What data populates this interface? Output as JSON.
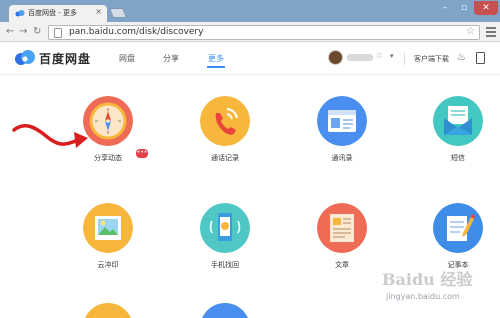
{
  "browser": {
    "tab_title": "百度网盘 - 更多",
    "tab_close": "×",
    "url": "pan.baidu.com/disk/discovery",
    "back_icon": "arrow-left",
    "forward_icon": "arrow-right",
    "reload_icon": "reload",
    "star_icon": "☆"
  },
  "window": {
    "minimize": "–",
    "maximize": "▫",
    "close": "✕"
  },
  "header": {
    "logo_text": "百度网盘",
    "nav": [
      {
        "label": "网盘",
        "active": false
      },
      {
        "label": "分享",
        "active": false
      },
      {
        "label": "更多",
        "active": true
      }
    ],
    "client_download": "客户端下载",
    "caret": "▾",
    "badge": "♔",
    "bell": "🔔"
  },
  "apps": [
    {
      "label": "分享动态",
      "icon": "compass-icon",
      "color": "#f06b55",
      "new_badge": "•••"
    },
    {
      "label": "通话记录",
      "icon": "phone-icon",
      "color": "#f7b63c"
    },
    {
      "label": "通讯录",
      "icon": "contact-card-icon",
      "color": "#4a8ff0"
    },
    {
      "label": "短信",
      "icon": "envelope-icon",
      "color": "#43c7c2"
    },
    {
      "label": "云冲印",
      "icon": "photo-icon",
      "color": "#f7b63c"
    },
    {
      "label": "手机找回",
      "icon": "phone-find-icon",
      "color": "#4fc7c4"
    },
    {
      "label": "文章",
      "icon": "document-icon",
      "color": "#f06b55"
    },
    {
      "label": "记事本",
      "icon": "notepad-icon",
      "color": "#3f8de8"
    }
  ],
  "watermark": {
    "logo": "Baidu 经验",
    "text": "jingyan.baidu.com"
  },
  "colors": {
    "accent": "#3b8cff",
    "arrow": "#d81e1e"
  }
}
